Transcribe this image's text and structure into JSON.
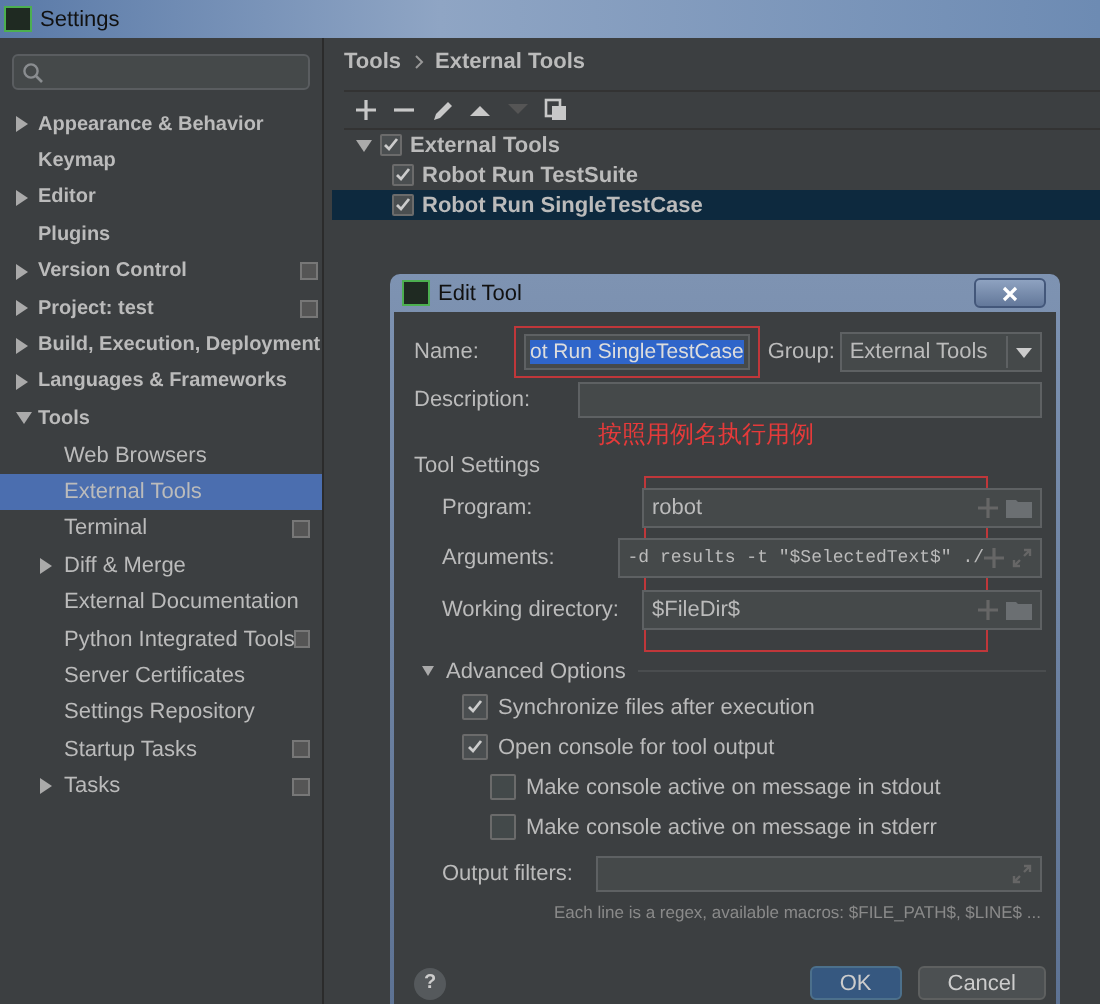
{
  "window": {
    "title": "Settings"
  },
  "sidebar": {
    "items": [
      {
        "label": "Appearance & Behavior",
        "expanded": false,
        "project_scope": false,
        "selected": false
      },
      {
        "label": "Keymap",
        "project_scope": false,
        "selected": false
      },
      {
        "label": "Editor",
        "expanded": false,
        "project_scope": false,
        "selected": false
      },
      {
        "label": "Plugins",
        "project_scope": false,
        "selected": false
      },
      {
        "label": "Version Control",
        "expanded": false,
        "project_scope": true,
        "selected": false
      },
      {
        "label": "Project: test",
        "expanded": false,
        "project_scope": true,
        "selected": false
      },
      {
        "label": "Build, Execution, Deployment",
        "expanded": false,
        "project_scope": false,
        "selected": false
      },
      {
        "label": "Languages & Frameworks",
        "expanded": false,
        "project_scope": false,
        "selected": false
      },
      {
        "label": "Tools",
        "expanded": true,
        "project_scope": false,
        "selected": false,
        "children": [
          {
            "label": "Web Browsers",
            "project_scope": false,
            "selected": false
          },
          {
            "label": "External Tools",
            "project_scope": false,
            "selected": true
          },
          {
            "label": "Terminal",
            "project_scope": true,
            "selected": false
          },
          {
            "label": "Diff & Merge",
            "expanded": false,
            "project_scope": false,
            "selected": false
          },
          {
            "label": "External Documentation",
            "project_scope": false,
            "selected": false
          },
          {
            "label": "Python Integrated Tools",
            "project_scope": true,
            "selected": false
          },
          {
            "label": "Server Certificates",
            "project_scope": false,
            "selected": false
          },
          {
            "label": "Settings Repository",
            "project_scope": false,
            "selected": false
          },
          {
            "label": "Startup Tasks",
            "project_scope": true,
            "selected": false
          },
          {
            "label": "Tasks",
            "expanded": false,
            "project_scope": true,
            "selected": false
          }
        ]
      }
    ]
  },
  "breadcrumb": [
    "Tools",
    "External Tools"
  ],
  "toolbar": [
    {
      "kind": "add",
      "disabled": false
    },
    {
      "kind": "remove",
      "disabled": false
    },
    {
      "kind": "edit",
      "disabled": false
    },
    {
      "kind": "up",
      "disabled": false
    },
    {
      "kind": "down",
      "disabled": true
    },
    {
      "kind": "copy",
      "disabled": false
    }
  ],
  "tool_tree": {
    "label": "External Tools",
    "checked": true,
    "expanded": true,
    "children": [
      {
        "label": "Robot Run TestSuite",
        "checked": true,
        "selected": false
      },
      {
        "label": "Robot Run SingleTestCase",
        "checked": true,
        "selected": true
      }
    ]
  },
  "dialog": {
    "title": "Edit Tool",
    "name_label": "Name:",
    "name_value": "ot Run SingleTestCase",
    "group_label": "Group:",
    "group_value": "External Tools",
    "description_label": "Description:",
    "annotation": "按照用例名执行用例",
    "tool_settings": "Tool Settings",
    "fields": [
      {
        "label": "Program:",
        "value": "robot",
        "kind": "folder"
      },
      {
        "label": "Arguments:",
        "value": "-d results -t \"$SelectedText$\" ./",
        "kind": "expand"
      },
      {
        "label": "Working directory:",
        "value": "$FileDir$",
        "kind": "folder"
      }
    ],
    "advanced": {
      "label": "Advanced Options",
      "expanded": true
    },
    "options": [
      {
        "label": "Synchronize files after execution",
        "checked": true
      },
      {
        "label": "Open console for tool output",
        "checked": true,
        "children": [
          {
            "label": "Make console active on message in stdout",
            "checked": false
          },
          {
            "label": "Make console active on message in stderr",
            "checked": false
          }
        ]
      }
    ],
    "output_filters_label": "Output filters:",
    "hint": "Each line is a regex, available macros: $FILE_PATH$, $LINE$ ...",
    "help": "?",
    "buttons": [
      {
        "label": "OK",
        "kind": "default"
      },
      {
        "label": "Cancel",
        "kind": "normal"
      }
    ]
  }
}
